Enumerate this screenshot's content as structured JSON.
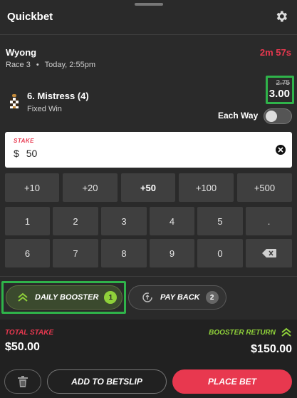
{
  "header": {
    "title": "Quickbet",
    "settings_icon": "gear-icon"
  },
  "race": {
    "name": "Wyong",
    "race_number": "Race 3",
    "separator": "•",
    "time": "Today, 2:55pm",
    "countdown": "2m 57s"
  },
  "runner": {
    "name": "6. Mistress (4)",
    "bet_type": "Fixed Win",
    "old_odds": "2.75",
    "new_odds": "3.00",
    "each_way_label": "Each Way",
    "each_way_on": false
  },
  "stake": {
    "label": "STAKE",
    "currency": "$",
    "value": "50"
  },
  "quick_amounts": [
    "+10",
    "+20",
    "+50",
    "+100",
    "+500"
  ],
  "keypad": {
    "row1": [
      "1",
      "2",
      "3",
      "4",
      "5",
      "."
    ],
    "row2": [
      "6",
      "7",
      "8",
      "9",
      "0"
    ]
  },
  "promos": {
    "booster": {
      "label": "DAILY BOOSTER",
      "count": "1"
    },
    "payback": {
      "label": "PAY BACK",
      "count": "2"
    }
  },
  "footer": {
    "total_stake_label": "TOTAL STAKE",
    "total_stake": "$50.00",
    "booster_return_label": "BOOSTER RETURN",
    "booster_return": "$150.00",
    "add_to_betslip": "ADD TO BETSLIP",
    "place_bet": "PLACE BET"
  },
  "colors": {
    "accent_red": "#e8384f",
    "booster_green": "#8fd13a",
    "highlight_green": "#2fb34a",
    "background": "#2a2a2a"
  }
}
